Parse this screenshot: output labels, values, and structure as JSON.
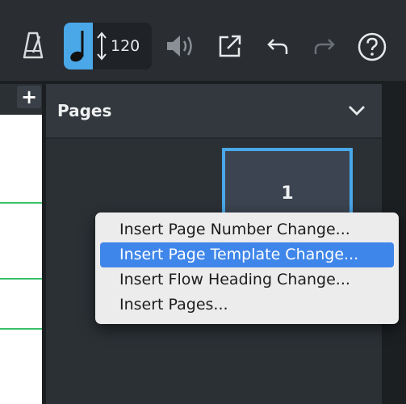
{
  "toolbar": {
    "metronome_icon": "metronome-icon",
    "tempo_note_icon": "quarter-note-icon",
    "tempo_arrow_icon": "vertical-arrows-icon",
    "tempo_value": "120",
    "volume_icon": "speaker-icon",
    "export_icon": "share-export-icon",
    "undo_icon": "undo-icon",
    "redo_icon": "redo-icon",
    "help_icon": "help-icon"
  },
  "score": {
    "add_tab_label": "+"
  },
  "pages_panel": {
    "title": "Pages",
    "collapse_icon": "chevron-down-icon",
    "page_number": "1"
  },
  "context_menu": {
    "items": [
      {
        "label": "Insert Page Number Change...",
        "highlighted": false
      },
      {
        "label": "Insert Page Template Change...",
        "highlighted": true
      },
      {
        "label": "Insert Flow Heading Change...",
        "highlighted": false
      },
      {
        "label": "Insert Pages...",
        "highlighted": false
      }
    ]
  },
  "colors": {
    "accent": "#4aa7e8",
    "menu_highlight": "#3f86ea",
    "staff_green": "#39c06a"
  }
}
